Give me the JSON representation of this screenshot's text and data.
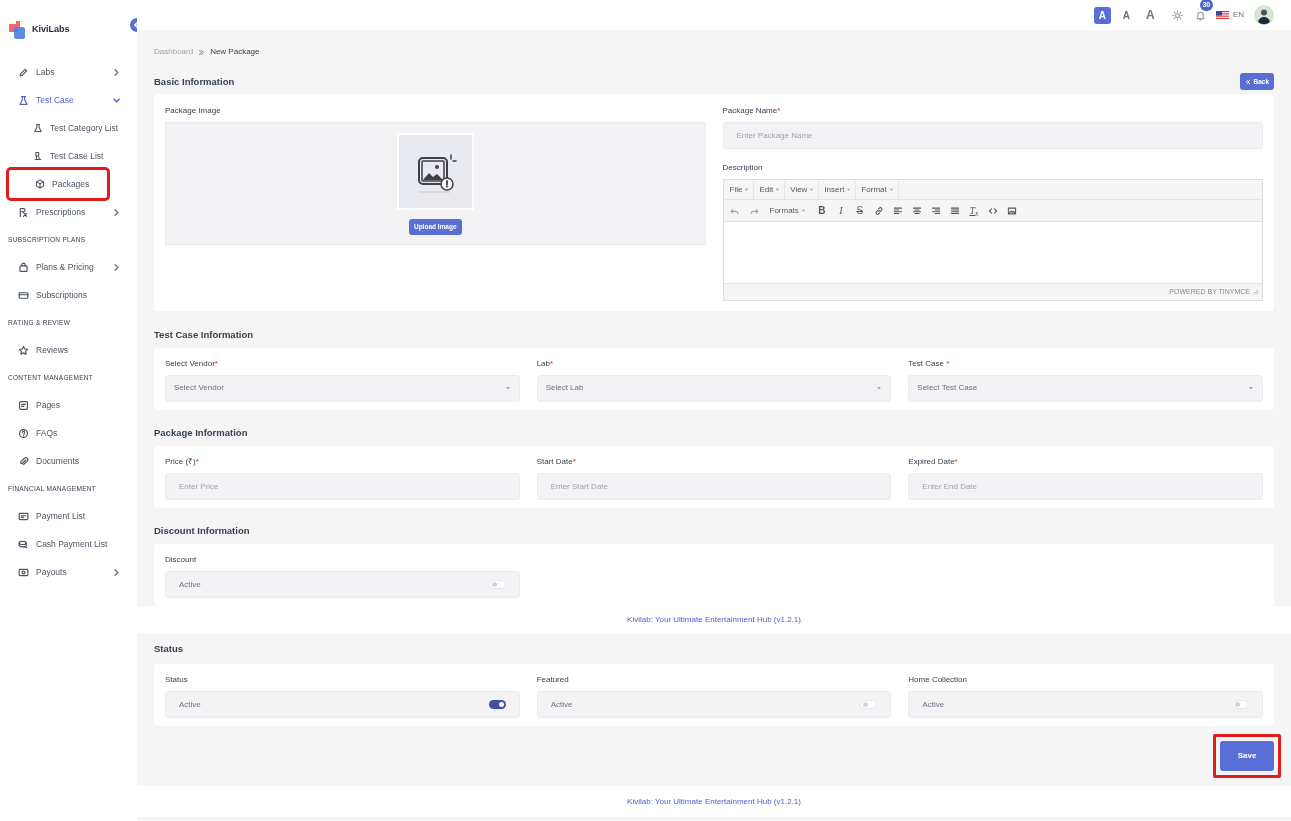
{
  "brand": {
    "name": "KiviLabs"
  },
  "sidebar": {
    "items": [
      {
        "kind": "item",
        "label": "Labs",
        "expanded": false
      },
      {
        "kind": "item",
        "label": "Test Case",
        "expanded": true,
        "children": [
          {
            "label": "Test Category List",
            "highlighted": false
          },
          {
            "label": "Test Case List",
            "highlighted": false
          },
          {
            "label": "Packages",
            "highlighted": true
          }
        ]
      },
      {
        "kind": "item",
        "label": "Prescriptions",
        "expanded": false
      },
      {
        "kind": "heading",
        "label": "SUBSCRIPTION PLANS"
      },
      {
        "kind": "item",
        "label": "Plans & Pricing",
        "expanded": false
      },
      {
        "kind": "item",
        "label": "Subscriptions"
      },
      {
        "kind": "heading",
        "label": "RATING & REVIEW"
      },
      {
        "kind": "item",
        "label": "Reviews"
      },
      {
        "kind": "heading",
        "label": "CONTENT MANAGEMENT"
      },
      {
        "kind": "item",
        "label": "Pages"
      },
      {
        "kind": "item",
        "label": "FAQs"
      },
      {
        "kind": "item",
        "label": "Documents"
      },
      {
        "kind": "heading",
        "label": "FINANCIAL MANAGEMENT"
      },
      {
        "kind": "item",
        "label": "Payment List"
      },
      {
        "kind": "item",
        "label": "Cash Payment List"
      },
      {
        "kind": "item",
        "label": "Payouts",
        "expanded": false
      }
    ]
  },
  "topbar": {
    "font_sizes": [
      {
        "label": "A",
        "selected": true
      },
      {
        "label": "A",
        "selected": false
      },
      {
        "label": "A",
        "selected": false
      }
    ],
    "notification_count": "30",
    "language": "EN"
  },
  "breadcrumb": [
    "Dashboard",
    "New Package"
  ],
  "basic_information": {
    "title": "Basic Information",
    "back_button": "Back",
    "image": {
      "label": "Package Image",
      "button": "Upload Image"
    },
    "package_name": {
      "label": "Package Name",
      "required_mark": "*",
      "placeholder": "Enter Package Name"
    },
    "description": {
      "label": "Description",
      "menus": [
        "File",
        "Edit",
        "View",
        "Insert",
        "Format"
      ],
      "toolbar": [
        {
          "kind": "icon"
        },
        {
          "kind": "icon"
        },
        {
          "kind": "menu",
          "label": "Formats"
        },
        {
          "kind": "text",
          "label": "B"
        },
        {
          "kind": "text",
          "label": "I"
        },
        {
          "kind": "text",
          "label": "S"
        },
        {
          "kind": "icon"
        },
        {
          "kind": "icon"
        },
        {
          "kind": "icon"
        },
        {
          "kind": "icon"
        },
        {
          "kind": "icon"
        },
        {
          "kind": "text",
          "label": "T$_{x}$"
        },
        {
          "kind": "icon"
        },
        {
          "kind": "icon"
        }
      ],
      "status": "POWERED BY TINYMCE"
    }
  },
  "sections": [
    {
      "title": "Test Case Information",
      "fields": [
        {
          "kind": "select",
          "label": "Select Vendor",
          "required_mark": "*",
          "placeholder": "Select Vendor"
        },
        {
          "kind": "select",
          "label": "Lab",
          "required_mark": "*",
          "placeholder": "Select Lab"
        },
        {
          "kind": "select",
          "label": "Test Case ",
          "required_mark": "*",
          "placeholder": "Select Test Case"
        }
      ]
    },
    {
      "title": "Package Information",
      "fields": [
        {
          "kind": "text",
          "label": "Price (₹)",
          "required_mark": "*",
          "placeholder": "Enter Price"
        },
        {
          "kind": "text",
          "label": "Start Date",
          "required_mark": "*",
          "placeholder": "Enter Start Date"
        },
        {
          "kind": "text",
          "label": "Expired Date",
          "required_mark": "*",
          "placeholder": "Enter End Date"
        }
      ]
    },
    {
      "title": "Discount Information",
      "fields": [
        {
          "kind": "toggle",
          "label": "Discount",
          "value": "Active",
          "on": false
        }
      ]
    }
  ],
  "footer_1": "Kivilab: Your Ultimate Entertainment Hub (v1.2.1)",
  "status_section": {
    "title": "Status",
    "fields": [
      {
        "kind": "toggle",
        "label": "Status",
        "value": "Active",
        "on": true
      },
      {
        "kind": "toggle",
        "label": "Featured",
        "value": "Active",
        "on": false
      },
      {
        "kind": "toggle",
        "label": "Home Collection",
        "value": "Active",
        "on": false
      }
    ]
  },
  "save_button": {
    "label": "Save",
    "highlighted": true
  },
  "footer_2": "Kivilab: Your Ultimate Entertainment Hub (v1.2.1)"
}
